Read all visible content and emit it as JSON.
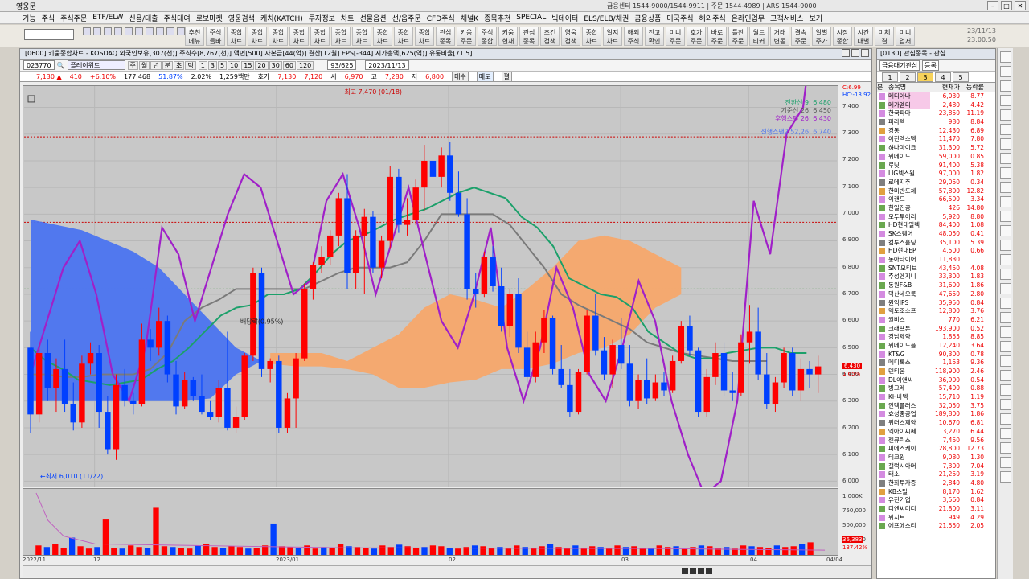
{
  "app": {
    "title": "영웅문",
    "info": "금융센터 1544-9000/1544-9911 | 주문 1544-4989 | ARS 1544-9000"
  },
  "menu": [
    "기능",
    "주식",
    "주식주문",
    "ETF/ELW",
    "신용/대출",
    "주식대여",
    "로보마켓",
    "영웅검색",
    "캐치(KATCH)",
    "투자정보",
    "차트",
    "선물옵션",
    "선/옵주문",
    "CFD주식",
    "채널K",
    "종목추천",
    "SPECIAL",
    "빅데이터",
    "ELS/ELB/채권",
    "금융상품",
    "미국주식",
    "해외주식",
    "온라인업무",
    "고객서비스",
    "보기"
  ],
  "toolbar": {
    "buttons": [
      "추천\n메뉴",
      "주식\n들바",
      "종합\n차트",
      "종합\n차트",
      "종합\n차트",
      "종합\n차트",
      "종합\n차트",
      "종합\n차트",
      "종합\n차트",
      "종합\n차트",
      "종합\n차트",
      "종합\n차트",
      "관심\n종목",
      "키움\n주문",
      "주식\n종합",
      "키움\n현재",
      "관심\n종목",
      "조건\n검색",
      "영웅\n검색",
      "종합\n차트",
      "일지\n차트",
      "해외\n주식",
      "잔고\n확인",
      "미니\n주문",
      "호가\n주문",
      "바로\n주문",
      "틀찬\n주문",
      "월드\n티커",
      "거래\n변동",
      "결속\n주문",
      "일별\n주가",
      "시장\n종합",
      "시간\n대별",
      "미체\n결",
      "미니\n업저"
    ],
    "date": "23/11/13",
    "time": "23:00:50"
  },
  "chart_window": {
    "title": "[0600] 키움종합차트 - KOSDAQ 외국인보유[307(천)] 주식수[8,767(천)] 액면[500] 자본금[44(억)] 결산[12월] EPS[-344] 시가총액[625(억)] 유통비율[71.5]",
    "code": "023770",
    "name": "플레이위드",
    "periods": [
      "주",
      "월",
      "년",
      "분",
      "초",
      "틱"
    ],
    "minutes": [
      "1",
      "3",
      "5",
      "10",
      "15",
      "20",
      "30",
      "60",
      "120"
    ],
    "count": "93/625",
    "date": "2023/11/13",
    "price": {
      "current": "7,130",
      "arrow": "▲",
      "change": "410",
      "rate": "+6.10%",
      "volume": "177,468",
      "vol_rate": "51.87%",
      "turnover": "2.02%",
      "amount": "1,259백만",
      "hoga_label": "호가",
      "ask": "7,130",
      "bid": "7,120",
      "high_label": "시",
      "high": "6,970",
      "hi_label": "고",
      "hi": "7,280",
      "lo_label": "저",
      "lo": "6,800",
      "buy": "매수",
      "sell": "매도",
      "extra": "펼"
    },
    "annotations": {
      "high": "최고 7,470 (01/18)",
      "low": "←최저 6,010 (11/22)",
      "div": "배당락(0.95%)",
      "conv": "전환선 9: 6,480",
      "base": "기준선 26: 6,450",
      "lag": "후행스팬 26: 6,430",
      "span": "선행스팬2 52,26: 6,740",
      "c_label": "C:6.99",
      "hc_label": "HC:-13.92",
      "last_price": "6,430",
      "last_pct": "1.65%",
      "vol_last": "36,383",
      "vol_pct": "137.42%"
    },
    "y_ticks": [
      "7,400",
      "7,300",
      "7,200",
      "7,100",
      "7,000",
      "6,900",
      "6,800",
      "6,700",
      "6,600",
      "6,500",
      "6,400",
      "6,300",
      "6,200",
      "6,100",
      "6,000"
    ],
    "vol_ticks": [
      "1,000K",
      "750,000",
      "500,000",
      "250,000"
    ],
    "x_ticks": [
      "2022/11",
      "12",
      "2023/01",
      "02",
      "03",
      "04",
      "04/04"
    ]
  },
  "chart_data": {
    "type": "candlestick",
    "ylim": [
      5980,
      7480
    ],
    "candles": [
      [
        6500,
        6560,
        6180,
        6250
      ],
      [
        6250,
        6520,
        6220,
        6480
      ],
      [
        6480,
        6530,
        6300,
        6350
      ],
      [
        6350,
        6460,
        6260,
        6420
      ],
      [
        6420,
        6530,
        6260,
        6290
      ],
      [
        6290,
        6370,
        6190,
        6220
      ],
      [
        6220,
        6470,
        6200,
        6440
      ],
      [
        6440,
        6520,
        6400,
        6480
      ],
      [
        6480,
        6510,
        6200,
        6260
      ],
      [
        6260,
        6320,
        6100,
        6120
      ],
      [
        6120,
        6400,
        6080,
        6360
      ],
      [
        6360,
        6420,
        6280,
        6300
      ],
      [
        6300,
        6330,
        6250,
        6290
      ],
      [
        6290,
        6590,
        6280,
        6530
      ],
      [
        6530,
        6570,
        6450,
        6500
      ],
      [
        6500,
        6650,
        6470,
        6600
      ],
      [
        6600,
        6620,
        6370,
        6400
      ],
      [
        6400,
        6450,
        6250,
        6280
      ],
      [
        6280,
        6410,
        6270,
        6380
      ],
      [
        6380,
        6390,
        6300,
        6320
      ],
      [
        6320,
        6400,
        6250,
        6260
      ],
      [
        6260,
        6300,
        6230,
        6240
      ],
      [
        6240,
        6380,
        6220,
        6350
      ],
      [
        6350,
        6560,
        6190,
        6200
      ],
      [
        6200,
        6280,
        6180,
        6240
      ],
      [
        6240,
        6480,
        6230,
        6470
      ],
      [
        6470,
        6800,
        6450,
        6780
      ],
      [
        6780,
        6800,
        6390,
        6420
      ],
      [
        6420,
        6460,
        6370,
        6450
      ],
      [
        6450,
        6470,
        6180,
        6200
      ],
      [
        6200,
        6330,
        6180,
        6310
      ],
      [
        6310,
        6480,
        6200,
        6460
      ],
      [
        6460,
        6740,
        6450,
        6720
      ],
      [
        6720,
        6820,
        6680,
        6810
      ],
      [
        6810,
        6880,
        6780,
        6840
      ],
      [
        6840,
        6940,
        6810,
        6920
      ],
      [
        6920,
        7080,
        6880,
        7060
      ],
      [
        7060,
        7150,
        6720,
        6780
      ],
      [
        6780,
        6940,
        6720,
        6920
      ],
      [
        6920,
        7020,
        6700,
        6990
      ],
      [
        6990,
        7010,
        6780,
        6800
      ],
      [
        6800,
        6920,
        6760,
        6900
      ],
      [
        6900,
        7180,
        6870,
        7140
      ],
      [
        7140,
        7170,
        6930,
        6960
      ],
      [
        6960,
        7060,
        6920,
        6980
      ],
      [
        6980,
        7130,
        6960,
        7100
      ],
      [
        7100,
        7260,
        7010,
        7200
      ],
      [
        7200,
        7230,
        7120,
        7140
      ],
      [
        7140,
        7250,
        7100,
        7220
      ],
      [
        7220,
        7270,
        7050,
        7080
      ],
      [
        7080,
        7160,
        6990,
        7000
      ],
      [
        7000,
        7060,
        6680,
        6720
      ],
      [
        6720,
        6780,
        6650,
        6700
      ],
      [
        6700,
        6860,
        6690,
        6840
      ],
      [
        6840,
        6880,
        6710,
        6730
      ],
      [
        6730,
        6800,
        6560,
        6580
      ],
      [
        6580,
        6720,
        6540,
        6700
      ],
      [
        6700,
        6760,
        6480,
        6500
      ],
      [
        6500,
        6560,
        6370,
        6390
      ],
      [
        6390,
        6560,
        6370,
        6520
      ],
      [
        6520,
        6640,
        6480,
        6610
      ],
      [
        6610,
        6620,
        6400,
        6420
      ],
      [
        6420,
        6510,
        6350,
        6360
      ],
      [
        6360,
        6420,
        6240,
        6260
      ],
      [
        6260,
        6420,
        6250,
        6410
      ],
      [
        6410,
        6640,
        6400,
        6620
      ],
      [
        6620,
        6700,
        6470,
        6490
      ],
      [
        6490,
        6540,
        6380,
        6400
      ],
      [
        6400,
        6530,
        6350,
        6510
      ],
      [
        6510,
        6610,
        6420,
        6440
      ],
      [
        6440,
        6510,
        6280,
        6300
      ],
      [
        6300,
        6400,
        6270,
        6380
      ],
      [
        6380,
        6460,
        6290,
        6310
      ],
      [
        6310,
        6400,
        6300,
        6370
      ],
      [
        6370,
        6410,
        6320,
        6340
      ],
      [
        6340,
        6470,
        6330,
        6450
      ],
      [
        6450,
        6600,
        6440,
        6580
      ],
      [
        6580,
        6620,
        6470,
        6490
      ],
      [
        6490,
        6500,
        6240,
        6260
      ],
      [
        6260,
        6420,
        6240,
        6390
      ],
      [
        6390,
        6520,
        6360,
        6480
      ],
      [
        6480,
        6520,
        6320,
        6340
      ],
      [
        6340,
        6410,
        6300,
        6330
      ],
      [
        6330,
        6550,
        6320,
        6520
      ],
      [
        6520,
        6660,
        6440,
        6560
      ],
      [
        6560,
        6650,
        6380,
        6400
      ],
      [
        6400,
        6480,
        6270,
        6290
      ],
      [
        6290,
        6390,
        6260,
        6370
      ],
      [
        6370,
        6500,
        6350,
        6480
      ],
      [
        6480,
        6500,
        6320,
        6340
      ],
      [
        6340,
        6460,
        6300,
        6420
      ],
      [
        6420,
        6450,
        6350,
        6400
      ],
      [
        6400,
        6470,
        6330,
        6430
      ]
    ],
    "conversion": [
      6500,
      6450,
      6420,
      6380,
      6370,
      6360,
      6370,
      6380,
      6420,
      6450,
      6500,
      6560,
      6620,
      6650,
      6660,
      6700,
      6700,
      6720,
      6780,
      6850,
      6900,
      6920,
      6950,
      6980,
      7000,
      7020,
      7050,
      7080,
      7100,
      7080,
      7060,
      6990,
      6950,
      6880,
      6760,
      6730,
      6700,
      6690,
      6650,
      6560,
      6520,
      6480,
      6460,
      6460,
      6480,
      6490,
      6500,
      6500,
      6480,
      6480
    ],
    "base": [
      6400,
      6400,
      6390,
      6390,
      6400,
      6400,
      6400,
      6420,
      6480,
      6600,
      6650,
      6680,
      6720,
      6720,
      6720,
      6720,
      6720,
      6750,
      6780,
      6800,
      6800,
      6800,
      6820,
      6900,
      7000,
      7000,
      7000,
      7000,
      6960,
      6880,
      6800,
      6700,
      6660,
      6630,
      6600,
      6570,
      6520,
      6500,
      6480,
      6470,
      6460,
      6450,
      6450,
      6450
    ],
    "lagging": [
      6400,
      6600,
      6800,
      6900,
      6700,
      6400,
      6300,
      6500,
      6950,
      6850,
      6600,
      6800,
      7000,
      7150,
      7100,
      6900,
      6700,
      6750,
      7050,
      7150,
      6950,
      6700,
      6900,
      7100,
      6850,
      6600,
      6500,
      6700,
      6950,
      6500,
      6300,
      6500,
      6800,
      6650,
      6400,
      6300,
      6500,
      6750,
      6600,
      6300,
      6100,
      5950,
      6000,
      6300,
      7050,
      6850,
      7300,
      7400,
      7900
    ],
    "cloud_blue": [
      [
        6980,
        6300
      ],
      [
        6960,
        6300
      ],
      [
        6940,
        6300
      ],
      [
        6900,
        6300
      ],
      [
        6860,
        6300
      ],
      [
        6800,
        6300
      ],
      [
        6700,
        6300
      ],
      [
        6600,
        6310
      ],
      [
        6500,
        6400
      ],
      [
        6450,
        6450
      ]
    ],
    "cloud_orange": [
      [
        6480,
        6440
      ],
      [
        6480,
        6430
      ],
      [
        6480,
        6430
      ],
      [
        6450,
        6420
      ],
      [
        6500,
        6400
      ],
      [
        6550,
        6350
      ],
      [
        6650,
        6350
      ],
      [
        6700,
        6370
      ],
      [
        6680,
        6380
      ],
      [
        6650,
        6420
      ],
      [
        6720,
        6420
      ],
      [
        6800,
        6440
      ],
      [
        6900,
        6480
      ],
      [
        6920,
        6500
      ],
      [
        6900,
        6550
      ],
      [
        6850,
        6650
      ],
      [
        6800,
        6700
      ]
    ],
    "volumes": [
      12,
      10,
      14,
      9,
      22,
      11,
      8,
      10,
      45,
      9,
      8,
      12,
      10,
      9,
      60,
      11,
      10,
      9,
      8,
      12,
      14,
      10,
      9,
      11,
      10,
      8,
      9,
      12,
      40,
      11,
      10,
      9,
      12,
      8,
      10,
      9,
      14,
      11,
      10,
      9,
      8,
      12,
      10,
      13,
      11,
      9,
      10,
      12,
      11,
      9,
      8,
      10,
      12,
      11,
      9,
      10,
      8,
      12,
      10,
      9,
      11,
      14,
      10,
      9,
      12,
      8,
      11,
      10,
      9,
      12,
      10,
      11,
      9,
      8,
      12,
      10,
      11,
      9,
      10,
      12,
      11,
      9,
      10,
      8,
      12,
      11,
      10,
      9,
      12,
      10,
      11,
      14,
      16
    ]
  },
  "watchlist": {
    "title": "[0130] 관심종목 - 관심...",
    "group": "금융대기관심",
    "register": "등록",
    "tabs": [
      "1",
      "2",
      "3",
      "4",
      "5"
    ],
    "headers": [
      "분",
      "종목명",
      "현재가",
      "등락률"
    ],
    "rows": [
      [
        "메디아나",
        "6,030",
        "8.77"
      ],
      [
        "메가엠디",
        "2,480",
        "4.42"
      ],
      [
        "한국파마",
        "23,850",
        "11.19"
      ],
      [
        "파라텍",
        "980",
        "8.84"
      ],
      [
        "경동",
        "12,430",
        "6.89"
      ],
      [
        "아진엑스텍",
        "11,470",
        "7.80"
      ],
      [
        "하나마이크",
        "31,300",
        "5.72"
      ],
      [
        "위메이드",
        "59,000",
        "0.85"
      ],
      [
        "루닛",
        "91,400",
        "5.38"
      ],
      [
        "LIG넥스원",
        "97,000",
        "1.82"
      ],
      [
        "로데지주",
        "29,050",
        "0.34"
      ],
      [
        "한미반도체",
        "57,800",
        "12.82"
      ],
      [
        "이랜드",
        "66,500",
        "3.34"
      ],
      [
        "한일진공",
        "426",
        "14.80"
      ],
      [
        "모두투어리",
        "5,920",
        "8.80"
      ],
      [
        "HD현대일렉",
        "84,400",
        "1.08"
      ],
      [
        "SK스퀘어",
        "48,050",
        "0.41"
      ],
      [
        "컴투스홀딩",
        "35,100",
        "5.39"
      ],
      [
        "HD현대EP",
        "4,500",
        "0.66"
      ],
      [
        "동아타이어",
        "11,830",
        ""
      ],
      [
        "SNT모티브",
        "43,450",
        "4.08"
      ],
      [
        "주성엔지니",
        "33,300",
        "1.83"
      ],
      [
        "동원F&B",
        "31,600",
        "1.86"
      ],
      [
        "덕산네오룩",
        "47,650",
        "2.80"
      ],
      [
        "원익IPS",
        "35,950",
        "0.84"
      ],
      [
        "덱토조소프",
        "12,800",
        "3.76"
      ],
      [
        "월비스",
        "770",
        "6.21"
      ],
      [
        "크래프톤",
        "193,900",
        "0.52"
      ],
      [
        "경남제약",
        "1,855",
        "8.85"
      ],
      [
        "위메이드플",
        "12,240",
        "3.64"
      ],
      [
        "KT&G",
        "90,300",
        "0.78"
      ],
      [
        "메디록스",
        "1,153",
        "9.36"
      ],
      [
        "덴티움",
        "118,900",
        "2.46"
      ],
      [
        "DL이앤씨",
        "36,900",
        "0.54"
      ],
      [
        "빙그레",
        "57,400",
        "0.88"
      ],
      [
        "KH바텍",
        "15,710",
        "1.19"
      ],
      [
        "인텍플러스",
        "32,050",
        "3.75"
      ],
      [
        "효성중공업",
        "189,800",
        "1.86"
      ],
      [
        "위더스제약",
        "10,670",
        "6.81"
      ],
      [
        "엑아이씨쎄",
        "3,270",
        "6.44"
      ],
      [
        "젠큐릭스",
        "7,450",
        "9.56"
      ],
      [
        "피에스케이",
        "28,800",
        "12.73"
      ],
      [
        "테크윙",
        "9,080",
        "1.30"
      ],
      [
        "갤럭시아머",
        "7,300",
        "7.04"
      ],
      [
        "태소",
        "21,250",
        "3.19"
      ],
      [
        "한화투자증",
        "2,840",
        "4.80"
      ],
      [
        "KB스틸",
        "8,170",
        "1.62"
      ],
      [
        "유진기업",
        "3,560",
        "0.84"
      ],
      [
        "디엔씨미디",
        "21,800",
        "3.11"
      ],
      [
        "위지트",
        "949",
        "4.29"
      ],
      [
        "에프에스티",
        "21,550",
        "2.05"
      ]
    ]
  },
  "colors": {
    "up": "#ff0000",
    "down": "#0040ff",
    "cloud_blue": "#4b74f0",
    "cloud_orange": "#f7a86c",
    "conv": "#1ba06a",
    "base": "#7a7a7a",
    "lag": "#a020c8",
    "plot_bg": "#c8c8c8"
  }
}
